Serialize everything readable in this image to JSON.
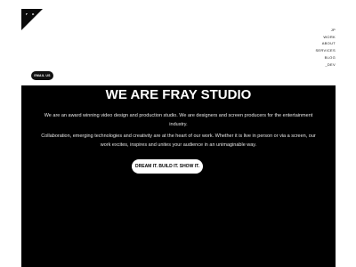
{
  "header": {
    "logo_text": "F R A Y"
  },
  "nav": {
    "items": [
      {
        "label": "JP"
      },
      {
        "label": "WORK"
      },
      {
        "label": "ABOUT"
      },
      {
        "label": "SERVICES"
      },
      {
        "label": "BLOG"
      },
      {
        "label": "_DEV"
      }
    ]
  },
  "email_button": {
    "label": "EMAIL US"
  },
  "hero": {
    "title": "WE ARE FRAY STUDIO",
    "paragraph_1": "We are an award winning video design and production studio. We are designers and screen producers for the entertainment industry.",
    "paragraph_2": "Collaboration, emerging technologies and creativity are at the heart of our work. Whether it is live in person or via a screen, our work excites, inspires and unites your audience in an unimaginable way.",
    "cta_label": "DREAM IT. BUILD IT. SHOW IT."
  },
  "colors": {
    "background": "#ffffff",
    "hero_background": "#000000",
    "text_dark": "#111111",
    "text_light": "#ffffff"
  }
}
